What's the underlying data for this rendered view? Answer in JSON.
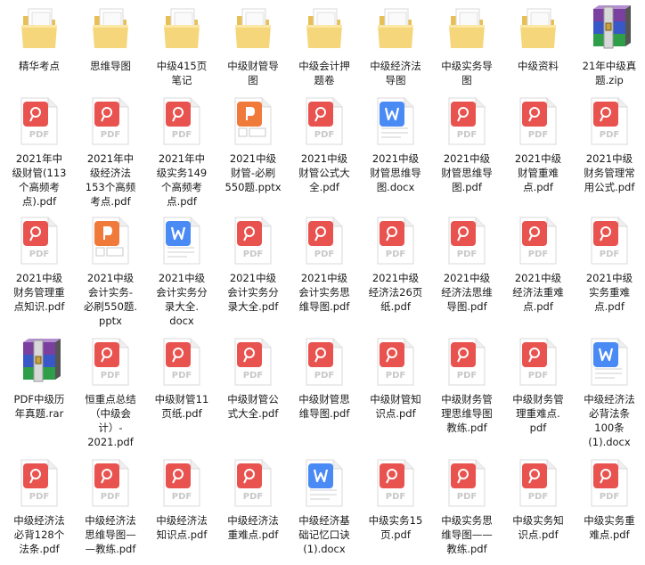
{
  "colors": {
    "folder": "#F5D67A",
    "pdf": "#E8534F",
    "pptx": "#F07A3A",
    "docx": "#4A8AF4",
    "rar_purple": "#7B3FA0",
    "rar_blue": "#3858C8",
    "rar_green": "#2E9E48"
  },
  "files": [
    {
      "type": "folder",
      "lines": [
        "精华考点"
      ]
    },
    {
      "type": "folder",
      "lines": [
        "思维导图"
      ]
    },
    {
      "type": "folder",
      "lines": [
        "中级415页",
        "笔记"
      ]
    },
    {
      "type": "folder",
      "lines": [
        "中级财管导",
        "图"
      ]
    },
    {
      "type": "folder",
      "lines": [
        "中级会计押",
        "题卷"
      ]
    },
    {
      "type": "folder",
      "lines": [
        "中级经济法",
        "导图"
      ]
    },
    {
      "type": "folder",
      "lines": [
        "中级实务导",
        "图"
      ]
    },
    {
      "type": "folder",
      "lines": [
        "中级资料"
      ]
    },
    {
      "type": "rar",
      "lines": [
        "21年中级真",
        "题.zip"
      ]
    },
    {
      "type": "pdf",
      "lines": [
        "2021年中",
        "级财管(113",
        "个高频考",
        "点).pdf"
      ]
    },
    {
      "type": "pdf",
      "lines": [
        "2021年中",
        "级经济法",
        "153个高频",
        "考点.pdf"
      ]
    },
    {
      "type": "pdf",
      "lines": [
        "2021年中",
        "级实务149",
        "个高频考",
        "点.pdf"
      ]
    },
    {
      "type": "pptx",
      "lines": [
        "2021中级",
        "财管-必刷",
        "550题.pptx"
      ]
    },
    {
      "type": "pdf",
      "lines": [
        "2021中级",
        "财管公式大",
        "全.pdf"
      ]
    },
    {
      "type": "docx",
      "lines": [
        "2021中级",
        "财管思维导",
        "图.docx"
      ]
    },
    {
      "type": "pdf",
      "lines": [
        "2021中级",
        "财管思维导",
        "图.pdf"
      ]
    },
    {
      "type": "pdf",
      "lines": [
        "2021中级",
        "财管重难",
        "点.pdf"
      ]
    },
    {
      "type": "pdf",
      "lines": [
        "2021中级",
        "财务管理常",
        "用公式.pdf"
      ]
    },
    {
      "type": "pdf",
      "lines": [
        "2021中级",
        "财务管理重",
        "点知识.pdf"
      ]
    },
    {
      "type": "pptx",
      "lines": [
        "2021中级",
        "会计实务-",
        "必刷550题.",
        "pptx"
      ]
    },
    {
      "type": "docx",
      "lines": [
        "2021中级",
        "会计实务分",
        "录大全.",
        "docx"
      ]
    },
    {
      "type": "pdf",
      "lines": [
        "2021中级",
        "会计实务分",
        "录大全.pdf"
      ]
    },
    {
      "type": "pdf",
      "lines": [
        "2021中级",
        "会计实务思",
        "维导图.pdf"
      ]
    },
    {
      "type": "pdf",
      "lines": [
        "2021中级",
        "经济法26页",
        "纸.pdf"
      ]
    },
    {
      "type": "pdf",
      "lines": [
        "2021中级",
        "经济法思维",
        "导图.pdf"
      ]
    },
    {
      "type": "pdf",
      "lines": [
        "2021中级",
        "经济法重难",
        "点.pdf"
      ]
    },
    {
      "type": "pdf",
      "lines": [
        "2021中级",
        "实务重难",
        "点.pdf"
      ]
    },
    {
      "type": "rar",
      "lines": [
        "PDF中级历",
        "年真题.rar"
      ]
    },
    {
      "type": "pdf",
      "lines": [
        "恒重点总结",
        "（中级会",
        "计）-",
        "2021.pdf"
      ]
    },
    {
      "type": "pdf",
      "lines": [
        "中级财管11",
        "页纸.pdf"
      ]
    },
    {
      "type": "pdf",
      "lines": [
        "中级财管公",
        "式大全.pdf"
      ]
    },
    {
      "type": "pdf",
      "lines": [
        "中级财管思",
        "维导图.pdf"
      ]
    },
    {
      "type": "pdf",
      "lines": [
        "中级财管知",
        "识点.pdf"
      ]
    },
    {
      "type": "pdf",
      "lines": [
        "中级财务管",
        "理思维导图",
        "教练.pdf"
      ]
    },
    {
      "type": "pdf",
      "lines": [
        "中级财务管",
        "理重难点.",
        "pdf"
      ]
    },
    {
      "type": "docx",
      "lines": [
        "中级经济法",
        "必背法条",
        "100条",
        "(1).docx"
      ]
    },
    {
      "type": "pdf",
      "lines": [
        "中级经济法",
        "必背128个",
        "法条.pdf"
      ]
    },
    {
      "type": "pdf",
      "lines": [
        "中级经济法",
        "思维导图—",
        "—教练.pdf"
      ]
    },
    {
      "type": "pdf",
      "lines": [
        "中级经济法",
        "知识点.pdf"
      ]
    },
    {
      "type": "pdf",
      "lines": [
        "中级经济法",
        "重难点.pdf"
      ]
    },
    {
      "type": "docx",
      "lines": [
        "中级经济基",
        "础记忆口诀",
        "(1).docx"
      ]
    },
    {
      "type": "pdf",
      "lines": [
        "中级实务15",
        "页.pdf"
      ]
    },
    {
      "type": "pdf",
      "lines": [
        "中级实务思",
        "维导图——",
        "教练.pdf"
      ]
    },
    {
      "type": "pdf",
      "lines": [
        "中级实务知",
        "识点.pdf"
      ]
    },
    {
      "type": "pdf",
      "lines": [
        "中级实务重",
        "难点.pdf"
      ]
    }
  ]
}
